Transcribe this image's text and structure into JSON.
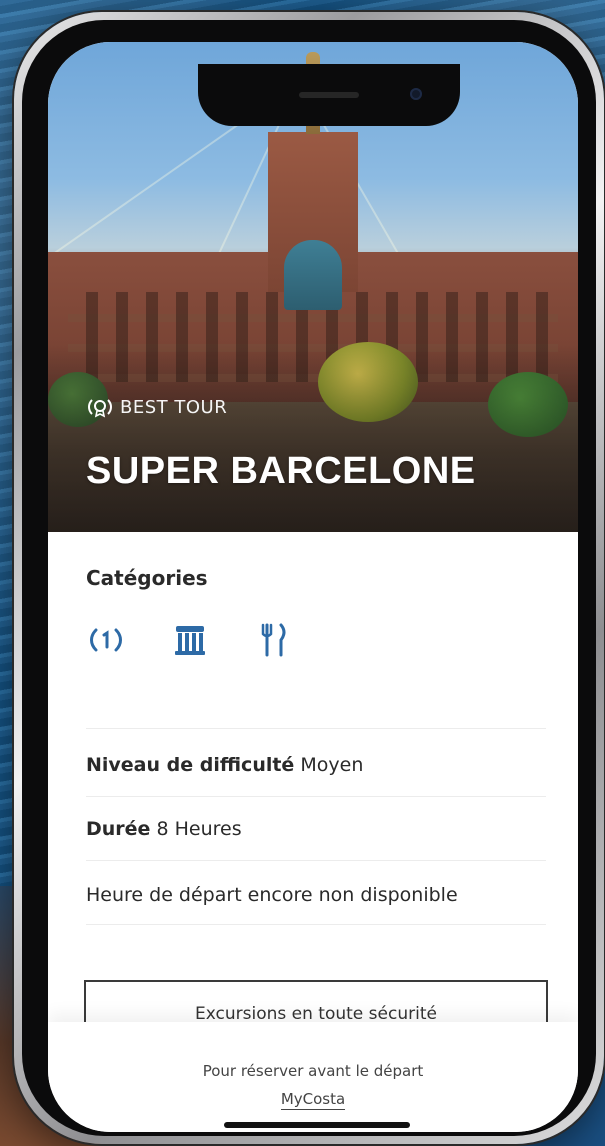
{
  "hero": {
    "badge_label": "BEST TOUR",
    "title": "SUPER BARCELONE"
  },
  "details": {
    "categories_title": "Catégories",
    "category_icons": [
      "award-icon",
      "museum-column-icon",
      "restaurant-icon"
    ],
    "difficulty_label": "Niveau de difficulté",
    "difficulty_value": "Moyen",
    "duration_label": "Durée",
    "duration_value": "8 Heures",
    "departure_text": "Heure de départ encore non disponible"
  },
  "actions": {
    "safety_label": "Excursions en toute sécurité"
  },
  "footer": {
    "booking_text": "Pour réserver avant le départ",
    "link_label": "MyCosta"
  },
  "colors": {
    "accent": "#2d6aa6",
    "text": "#2a2a2a"
  }
}
